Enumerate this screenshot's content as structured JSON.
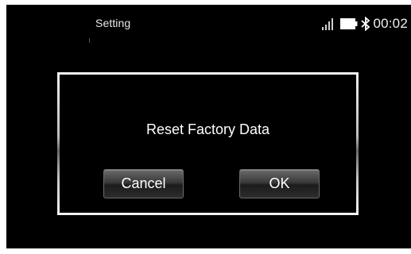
{
  "status_bar": {
    "title": "Setting",
    "time": "00:02",
    "icons": [
      "signal-icon",
      "battery-icon",
      "bluetooth-icon"
    ]
  },
  "dialog": {
    "message": "Reset Factory Data",
    "cancel_label": "Cancel",
    "ok_label": "OK"
  },
  "colors": {
    "background": "#000000",
    "text": "#ffffff",
    "dialog_border": "#d0d0d0",
    "button_top": "#6a6a6a",
    "button_bottom": "#1c1c1c"
  }
}
